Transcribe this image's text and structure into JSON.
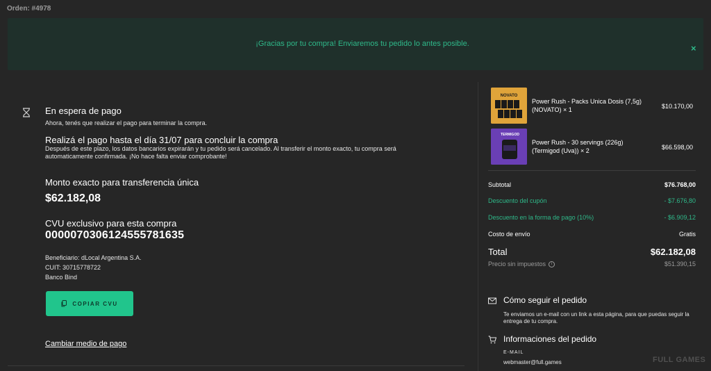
{
  "order": {
    "number": "Orden: #4978"
  },
  "banner": {
    "message": "¡Gracias por tu compra! Enviaremos tu pedido lo antes posible.",
    "close": "×"
  },
  "status": {
    "title": "En espera de pago",
    "subtitle": "Ahora, tenés que realizar el pago para terminar la compra."
  },
  "payment": {
    "deadline_title": "Realizá el pago hasta el día 31/07 para concluir la compra",
    "deadline_text": "Después de este plazo, los datos bancarios expirarán y tu pedido será cancelado. Al transferir el monto exacto, tu compra será automaticamente confirmada. ¡No hace falta enviar comprobante!",
    "amount_label": "Monto exacto para transferencia única",
    "amount_value": "$62.182,08",
    "cvu_label": "CVU exclusivo para esta compra",
    "cvu_value": "0000070306124555781635",
    "beneficiary": "Beneficiario: dLocal Argentina S.A.",
    "cuit": "CUIT: 30715778722",
    "bank": "Banco Bind",
    "copy_button": "COPIAR CVU",
    "change_link": "Cambiar medio de pago"
  },
  "products": [
    {
      "name": "Power Rush - Packs Unica Dosis (7,5g) (NOVATO) × 1",
      "price": "$10.170,00",
      "thumb_label": "NOVATO"
    },
    {
      "name": "Power Rush - 30 servings (226g) (Termigod (Uva)) × 2",
      "price": "$66.598,00",
      "thumb_label": "TERMIGOD"
    }
  ],
  "summary": {
    "subtotal_label": "Subtotal",
    "subtotal_value": "$76.768,00",
    "coupon_label": "Descuento del cupón",
    "coupon_value": "- $7.676,80",
    "paydisc_label": "Descuento en la forma de pago (10%)",
    "paydisc_value": "- $6.909,12",
    "shipping_label": "Costo de envío",
    "shipping_value": "Gratis",
    "total_label": "Total",
    "total_value": "$62.182,08",
    "notax_label": "Precio sin impuestos",
    "notax_value": "$51.390,15"
  },
  "tracking": {
    "title": "Cómo seguir el pedido",
    "text": "Te enviamos un e-mail con un link a esta página, para que puedas seguir la entrega de tu compra."
  },
  "info": {
    "title": "Informaciones del pedido",
    "email_label": "E-MAIL",
    "email_value": "webmaster@full.games"
  },
  "watermark": "FULL GAMES",
  "colors": {
    "accent": "#21c58c",
    "banner_bg": "#1f302b",
    "page_bg": "#262626"
  }
}
